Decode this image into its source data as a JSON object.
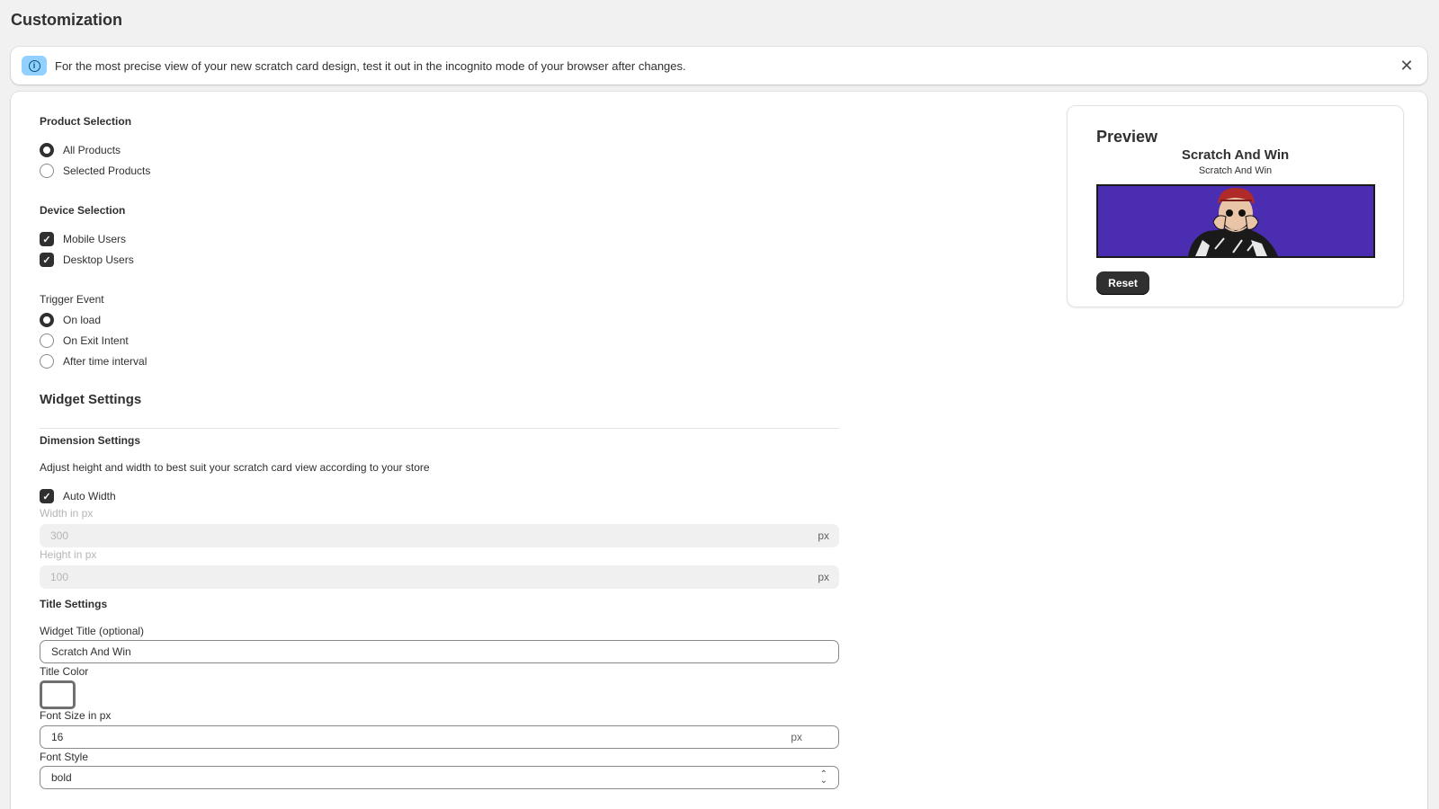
{
  "page": {
    "title": "Customization"
  },
  "banner": {
    "icon": "info-icon",
    "text": "For the most precise view of your new scratch card design, test it out in the incognito mode of your browser after changes.",
    "close_icon": "close-icon",
    "close_glyph": "✕",
    "info_glyph": "i"
  },
  "product_selection": {
    "label": "Product Selection",
    "options": [
      {
        "label": "All Products",
        "selected": true
      },
      {
        "label": "Selected Products",
        "selected": false
      }
    ]
  },
  "device_selection": {
    "label": "Device Selection",
    "options": [
      {
        "label": "Mobile Users",
        "checked": true
      },
      {
        "label": "Desktop Users",
        "checked": true
      }
    ]
  },
  "trigger_event": {
    "label": "Trigger Event",
    "options": [
      {
        "label": "On load",
        "selected": true
      },
      {
        "label": "On Exit Intent",
        "selected": false
      },
      {
        "label": "After time interval",
        "selected": false
      }
    ]
  },
  "widget_settings": {
    "heading": "Widget Settings",
    "dimension": {
      "heading": "Dimension Settings",
      "help": "Adjust height and width to best suit your scratch card view according to your store",
      "auto_width": {
        "label": "Auto Width",
        "checked": true
      },
      "width": {
        "label": "Width in px",
        "value": "300",
        "suffix": "px"
      },
      "height": {
        "label": "Height in px",
        "value": "100",
        "suffix": "px"
      }
    },
    "title": {
      "heading": "Title Settings",
      "widget_title": {
        "label": "Widget Title (optional)",
        "value": "Scratch And Win"
      },
      "title_color": {
        "label": "Title Color",
        "value": "#ffffff"
      },
      "font_size": {
        "label": "Font Size in px",
        "value": "16",
        "suffix": "px"
      },
      "font_style": {
        "label": "Font Style",
        "value": "bold"
      }
    }
  },
  "preview": {
    "title": "Preview",
    "widget_title": "Scratch And Win",
    "widget_subtitle": "Scratch And Win",
    "card_bg": "#4a2db0",
    "reset_label": "Reset"
  },
  "check_glyph": "✓"
}
